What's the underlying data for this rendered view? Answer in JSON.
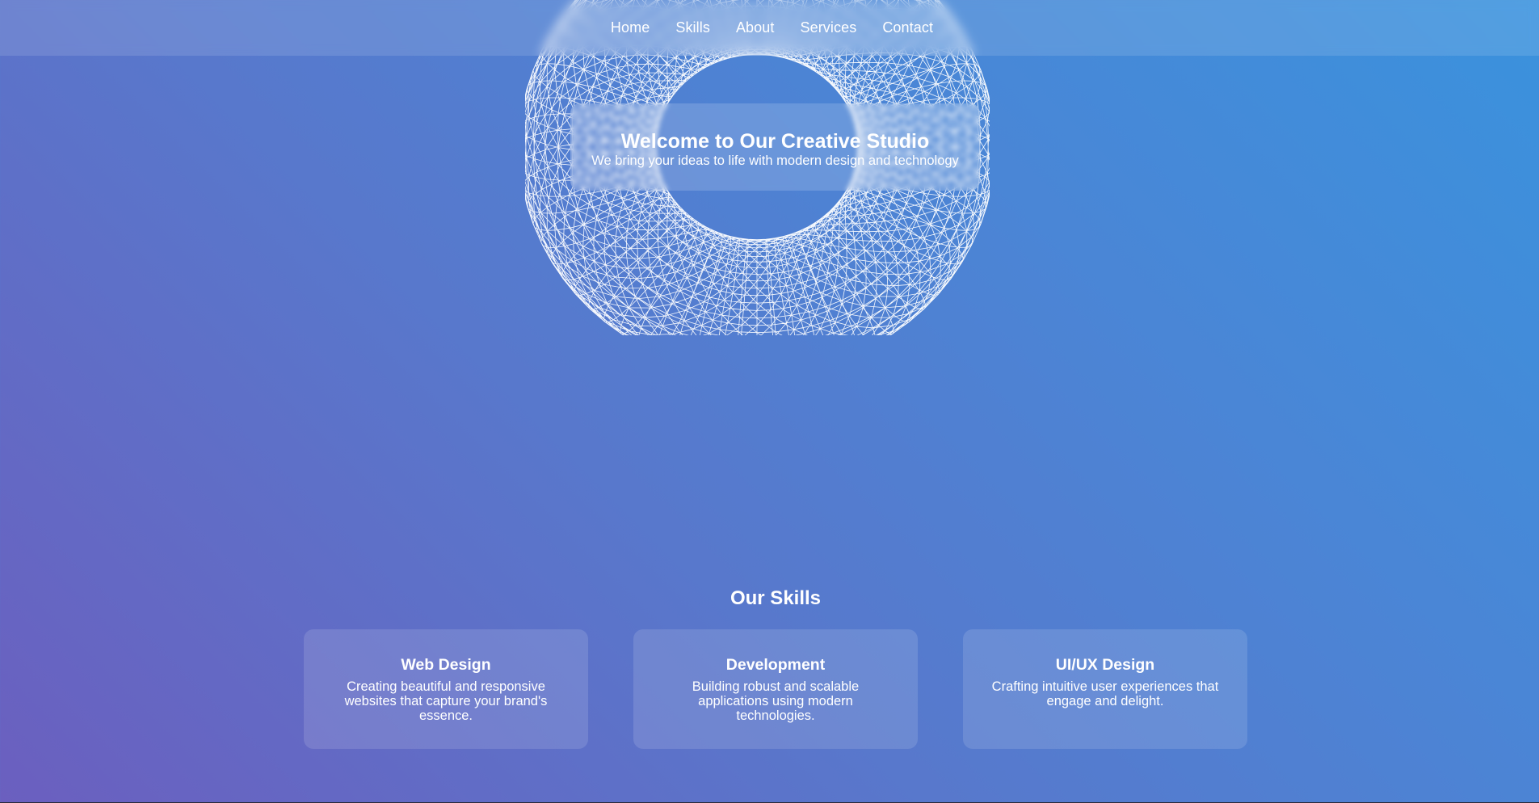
{
  "nav": {
    "items": [
      {
        "label": "Home"
      },
      {
        "label": "Skills"
      },
      {
        "label": "About"
      },
      {
        "label": "Services"
      },
      {
        "label": "Contact"
      }
    ]
  },
  "hero": {
    "title": "Welcome to Our Creative Studio",
    "subtitle": "We bring your ideas to life with modern design and technology"
  },
  "skills": {
    "heading": "Our Skills",
    "cards": [
      {
        "title": "Web Design",
        "description": "Creating beautiful and responsive websites that capture your brand's essence."
      },
      {
        "title": "Development",
        "description": "Building robust and scalable applications using modern technologies."
      },
      {
        "title": "UI/UX Design",
        "description": "Crafting intuitive user experiences that engage and delight."
      }
    ]
  },
  "colors": {
    "gradient_start": "#6b5fbf",
    "gradient_end": "#3a92dd",
    "text": "#ffffff"
  },
  "icons": {
    "hero_graphic": "torus-wireframe-icon"
  }
}
